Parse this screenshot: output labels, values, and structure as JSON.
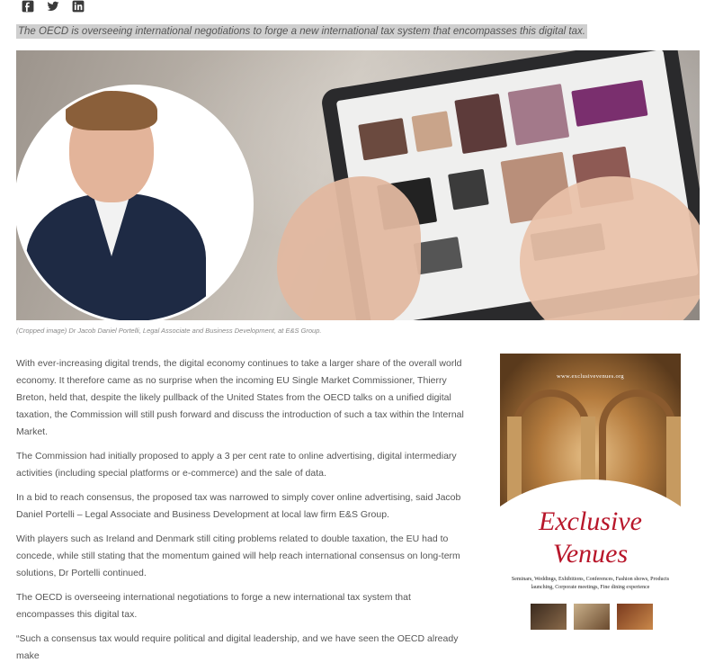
{
  "share": {
    "icons": [
      "facebook-icon",
      "twitter-icon",
      "linkedin-icon"
    ]
  },
  "pull_quote": "The OECD is overseeing international negotiations to forge a new international tax system that encompasses this digital tax.",
  "caption": "(Cropped image) Dr Jacob Daniel Portelli, Legal Associate and Business Development, at E&S Group.",
  "article": {
    "paragraphs": [
      "With ever-increasing digital trends, the digital economy continues to take a larger share of the overall world economy. It therefore came as no surprise when the incoming EU Single Market Commissioner, Thierry Breton, held that, despite the likely pullback of the United States from the OECD talks on a unified digital taxation, the Commission will still push forward and discuss the introduction of such a tax within the Internal Market.",
      "The Commission had initially proposed to apply a 3 per cent rate to online advertising, digital intermediary activities (including special platforms or e-commerce) and the sale of data.",
      "In a bid to reach consensus, the proposed tax was narrowed to simply cover online advertising, said Jacob Daniel Portelli – Legal Associate and Business Development at local law firm E&S Group.",
      "With players such as Ireland and Denmark still citing problems related to double taxation, the EU had to concede, while still stating that the momentum gained will help reach international consensus on long-term solutions, Dr Portelli continued.",
      "The OECD is overseeing international negotiations to forge a new international tax system that encompasses this digital tax.",
      "“Such a consensus tax would require political and digital leadership, and we have seen the OECD already make"
    ]
  },
  "ad": {
    "url": "www.exclusivevenues.org",
    "brand_line1": "Exclusive",
    "brand_line2": "Venues",
    "tagline": "Seminars, Weddings, Exhibitions, Conferences, Fashion shows, Products launching, Corporate meetings, Fine dining experience"
  },
  "colors": {
    "quote_bg": "#cfcfcf",
    "brand_red": "#b8162a"
  }
}
